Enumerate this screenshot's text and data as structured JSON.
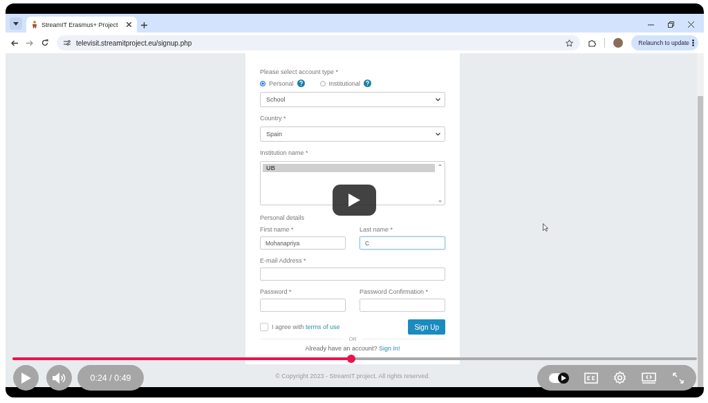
{
  "browser": {
    "tab": {
      "title": "StreamIT Erasmus+ Project"
    },
    "url": "televisit.streamitproject.eu/signup.php",
    "relaunch_button": "Relaunch to update"
  },
  "signup_form": {
    "account_type": {
      "label": "Please select account type *",
      "options": [
        {
          "label": "Personal",
          "selected": true
        },
        {
          "label": "Institutional",
          "selected": false
        }
      ]
    },
    "institution_type": {
      "value": "School"
    },
    "country": {
      "label": "Country *",
      "value": "Spain"
    },
    "institution_name": {
      "label": "Institution name *",
      "options": [
        {
          "text": "UB",
          "selected": true
        }
      ]
    },
    "section_title": "Personal details",
    "rows": [
      [
        {
          "label": "First name *",
          "value": "Mohanapriya",
          "focused": false
        },
        {
          "label": "Last name *",
          "value": "C",
          "focused": true
        }
      ],
      [
        {
          "label": "E-mail Address *",
          "focused": false
        }
      ],
      [
        {
          "label": "Password *",
          "focused": false
        },
        {
          "label": "Password Confirmation *",
          "focused": false
        }
      ]
    ],
    "terms": {
      "checked": false,
      "text": "I agree with",
      "link": "terms of use"
    },
    "submit_button": "Sign Up",
    "separator": "OR",
    "signin_prompt": {
      "text": "Already have an account?",
      "link": "Sign In!"
    },
    "copyright": "© Copyright 2023 - StreamIT project. All rights reserved."
  },
  "player": {
    "progress": {
      "level": 0.495
    },
    "time": "0:24 / 0:49",
    "autoplay": {
      "on": true
    }
  }
}
